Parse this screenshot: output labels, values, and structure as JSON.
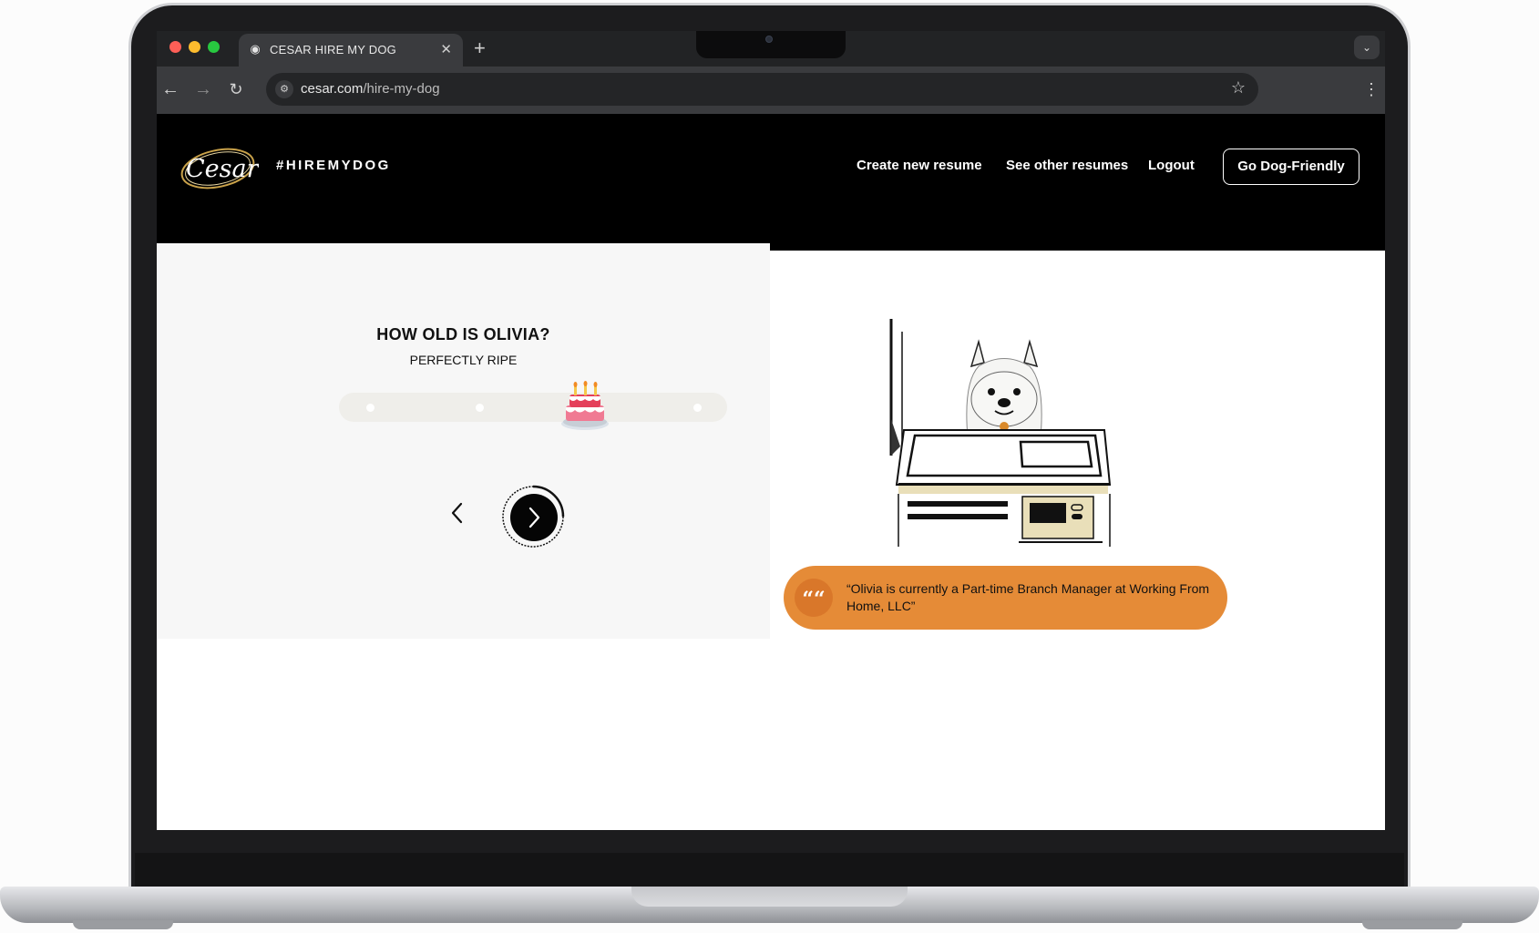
{
  "browser": {
    "tab_title": "CESAR HIRE MY DOG",
    "tab_favicon": "dog-favicon",
    "url_domain": "cesar.com",
    "url_path": "/hire-my-dog"
  },
  "site": {
    "logo_text": "Cesar",
    "hashtag": "#HIREMYDOG",
    "nav": {
      "create_resume": "Create new resume",
      "see_resumes": "See other resumes",
      "logout": "Logout"
    },
    "cta_label": "Go Dog-Friendly",
    "colors": {
      "header_bg": "#000000",
      "accent_orange": "#e58b37",
      "badge_orange": "#d9772a",
      "panel_bg": "#f7f7f7"
    }
  },
  "quiz": {
    "question": "HOW OLD IS OLIVIA?",
    "answer": "PERFECTLY RIPE",
    "slider": {
      "stops": 4,
      "selected_stop": 3,
      "thumb_icon": "birthday-cake-icon"
    }
  },
  "quote": {
    "mark": "““",
    "text": "“Olivia is currently a Part-time Branch Manager at Working From Home, LLC”"
  }
}
